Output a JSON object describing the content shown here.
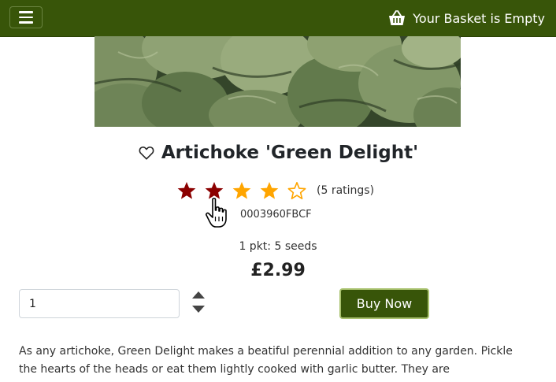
{
  "navbar": {
    "menu_icon": "hamburger-icon",
    "basket_icon": "basket-icon",
    "basket_text": "Your Basket is Empty",
    "brand_color": "#385509"
  },
  "product": {
    "title": "Artichoke 'Green Delight'",
    "favorite_icon": "heart-outline-icon",
    "rating": {
      "value": 4,
      "user_selected": 2,
      "max": 5,
      "count_text": "(5 ratings)"
    },
    "sku": "0003960FBCF",
    "pack_size": "1 pkt: 5 seeds",
    "price": "£2.99",
    "quantity": "1",
    "buy_label": "Buy Now",
    "description": "As any artichoke, Green Delight makes a beatiful perennial addition to any garden. Pickle the hearts of the heads or eat them lightly cooked with garlic butter. They are"
  },
  "colors": {
    "star_selected": "#8b0000",
    "star_filled": "#ffa500",
    "star_empty": "#ffa500"
  }
}
